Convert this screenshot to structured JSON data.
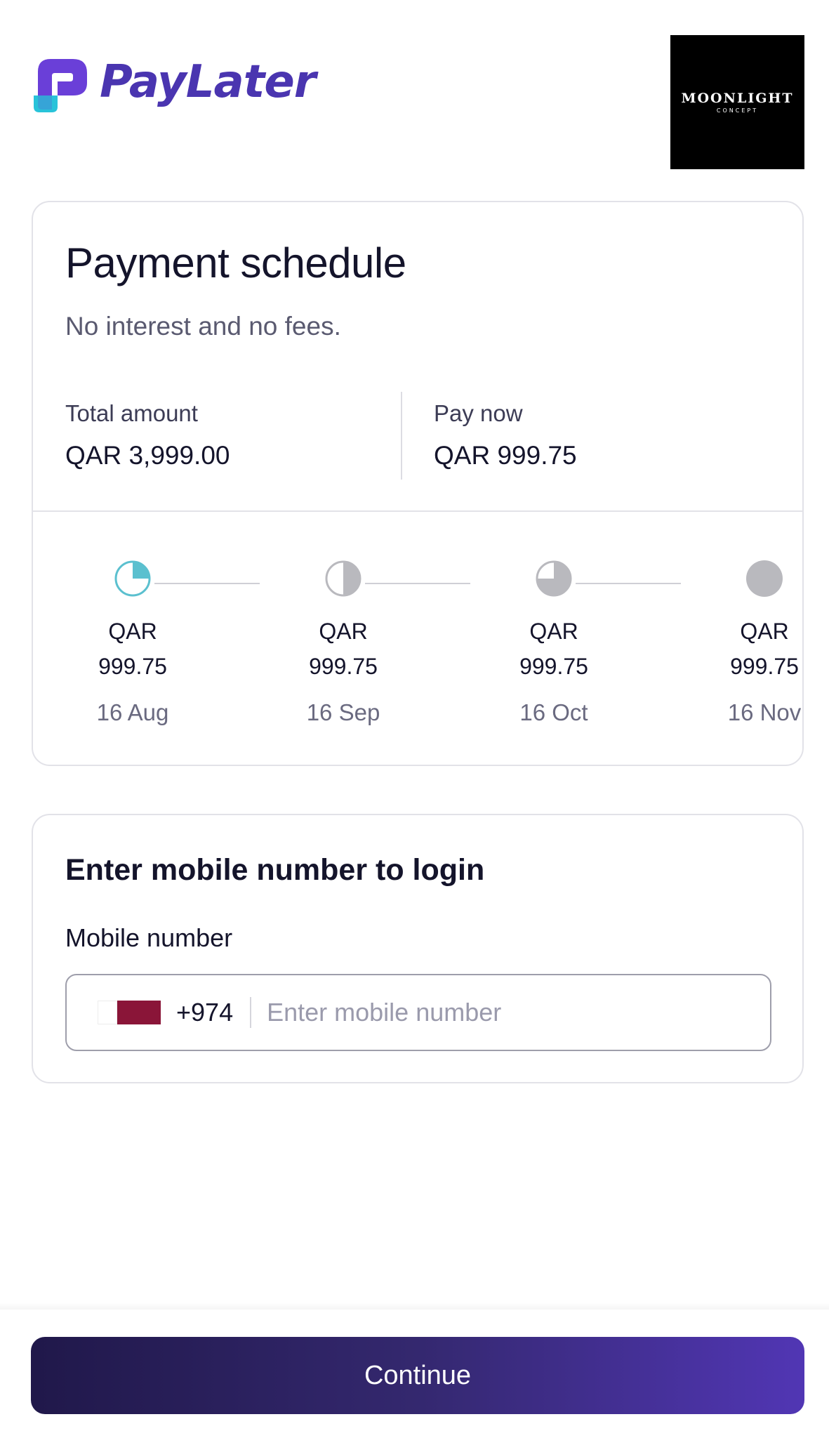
{
  "brand": {
    "name": "PayLater",
    "color": "#4a35b0",
    "accent": "#28c3d9"
  },
  "merchant": {
    "name": "MOONLIGHT",
    "tagline": "CONCEPT"
  },
  "schedule": {
    "title": "Payment schedule",
    "subtitle": "No interest and no fees.",
    "total_label": "Total amount",
    "total_value": "QAR 3,999.00",
    "pay_now_label": "Pay now",
    "pay_now_value": "QAR 999.75",
    "installments": [
      {
        "currency": "QAR",
        "amount": "999.75",
        "date": "16 Aug",
        "icon": "pie-quarter-icon",
        "status": "current"
      },
      {
        "currency": "QAR",
        "amount": "999.75",
        "date": "16 Sep",
        "icon": "pie-half-icon",
        "status": "upcoming"
      },
      {
        "currency": "QAR",
        "amount": "999.75",
        "date": "16 Oct",
        "icon": "pie-three-quarter-icon",
        "status": "upcoming"
      },
      {
        "currency": "QAR",
        "amount": "999.75",
        "date": "16 Nov",
        "icon": "pie-full-icon",
        "status": "upcoming"
      }
    ],
    "colors": {
      "current": "#5bc0cf",
      "upcoming": "#b9b9be"
    }
  },
  "login": {
    "title": "Enter mobile number to login",
    "mobile_label": "Mobile number",
    "country_flag": "qatar-flag-icon",
    "dial_code": "+974",
    "placeholder": "Enter mobile number",
    "value": ""
  },
  "footer": {
    "continue_label": "Continue"
  }
}
